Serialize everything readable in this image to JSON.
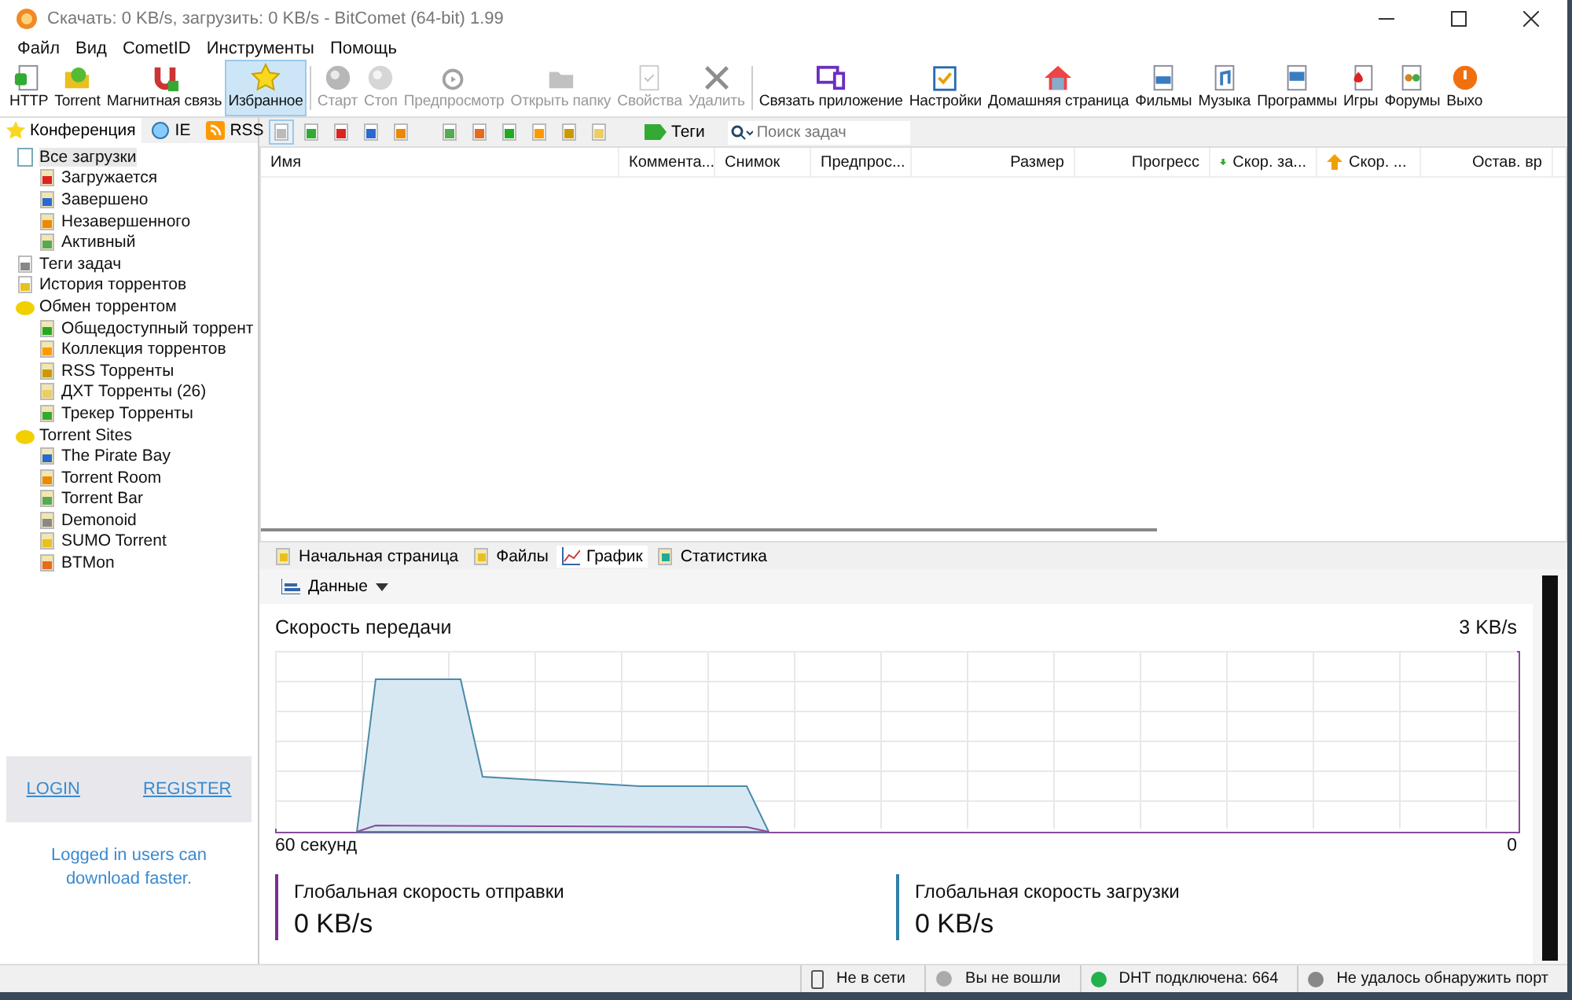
{
  "window": {
    "title": "Скачать: 0 KB/s, загрузить: 0 KB/s - BitComet (64-bit) 1.99"
  },
  "menu": [
    "Файл",
    "Вид",
    "CometID",
    "Инструменты",
    "Помощь"
  ],
  "toolbar": [
    {
      "label": "HTTP",
      "disabled": false,
      "selected": false
    },
    {
      "label": "Torrent",
      "disabled": false,
      "selected": false
    },
    {
      "label": "Магнитная связь",
      "disabled": false,
      "selected": false
    },
    {
      "label": "Избранное",
      "disabled": false,
      "selected": true
    },
    {
      "label": "Старт",
      "disabled": true,
      "selected": false
    },
    {
      "label": "Стоп",
      "disabled": true,
      "selected": false
    },
    {
      "label": "Предпросмотр",
      "disabled": true,
      "selected": false
    },
    {
      "label": "Открыть папку",
      "disabled": true,
      "selected": false
    },
    {
      "label": "Свойства",
      "disabled": true,
      "selected": false
    },
    {
      "label": "Удалить",
      "disabled": true,
      "selected": false
    },
    {
      "label": "Связать приложение",
      "disabled": false,
      "selected": false
    },
    {
      "label": "Настройки",
      "disabled": false,
      "selected": false
    },
    {
      "label": "Домашняя страница",
      "disabled": false,
      "selected": false
    },
    {
      "label": "Фильмы",
      "disabled": false,
      "selected": false
    },
    {
      "label": "Музыка",
      "disabled": false,
      "selected": false
    },
    {
      "label": "Программы",
      "disabled": false,
      "selected": false
    },
    {
      "label": "Игры",
      "disabled": false,
      "selected": false
    },
    {
      "label": "Форумы",
      "disabled": false,
      "selected": false
    },
    {
      "label": "Выхо",
      "disabled": false,
      "selected": false
    }
  ],
  "sidebar": {
    "tabs": [
      {
        "label": "Конференция",
        "selected": true
      },
      {
        "label": "IE",
        "selected": false
      },
      {
        "label": "RSS",
        "selected": false
      }
    ],
    "tree": [
      {
        "label": "Все загрузки",
        "selected": true,
        "children": [
          {
            "label": "Загружается",
            "selected": false
          },
          {
            "label": "Завершено",
            "selected": false
          },
          {
            "label": "Незавершенного",
            "selected": false
          },
          {
            "label": "Активный",
            "selected": false
          }
        ]
      },
      {
        "label": "Теги задач",
        "selected": false
      },
      {
        "label": "История торрентов",
        "selected": false
      },
      {
        "label": "Обмен торрентом",
        "selected": false,
        "children": [
          {
            "label": "Общедоступный торрент",
            "selected": false
          },
          {
            "label": "Коллекция торрентов",
            "selected": false
          },
          {
            "label": "RSS Торренты",
            "selected": false
          },
          {
            "label": "ДХТ Торренты (26)",
            "selected": false
          },
          {
            "label": "Трекер Торренты",
            "selected": false
          }
        ]
      },
      {
        "label": "Torrent Sites",
        "selected": false,
        "children": [
          {
            "label": "The Pirate Bay",
            "selected": false
          },
          {
            "label": "Torrent Room",
            "selected": false
          },
          {
            "label": "Torrent Bar",
            "selected": false
          },
          {
            "label": "Demonoid",
            "selected": false
          },
          {
            "label": "SUMO Torrent",
            "selected": false
          },
          {
            "label": "BTMon",
            "selected": false
          }
        ]
      }
    ],
    "login": "LOGIN",
    "register": "REGISTER",
    "note": "Logged in users can download faster."
  },
  "task_toolbar": {
    "tags": "Теги",
    "search": {
      "placeholder": "Поиск задач"
    }
  },
  "table": {
    "columns": [
      "Имя",
      "Коммента...",
      "Снимок",
      "Предпрос...",
      "Размер",
      "Прогресс",
      "Скор. за...",
      "Скор. ...",
      "Остав. вр"
    ]
  },
  "bottom_tabs": [
    {
      "label": "Начальная страница",
      "selected": false
    },
    {
      "label": "Файлы",
      "selected": false
    },
    {
      "label": "График",
      "selected": true
    },
    {
      "label": "Статистика",
      "selected": false
    }
  ],
  "graph": {
    "dropdown": "Данные",
    "title": "Скорость передачи",
    "max": "3 KB/s",
    "x_start": "60 секунд",
    "x_end": "0",
    "stats": [
      {
        "label": "Глобальная скорость отправки",
        "value": "0 KB/s",
        "color": "#7b2f8f"
      },
      {
        "label": "Глобальная скорость загрузки",
        "value": "0 KB/s",
        "color": "#2f7fa8"
      }
    ]
  },
  "status_bar": [
    {
      "text": "Не в сети",
      "color": "#555555"
    },
    {
      "text": "Вы не вошли",
      "color": "#aaaaaa"
    },
    {
      "text": "DHT подключена: 664",
      "color": "#22b14c"
    },
    {
      "text": "Не удалось обнаружить порт",
      "color": "#888888"
    }
  ]
}
